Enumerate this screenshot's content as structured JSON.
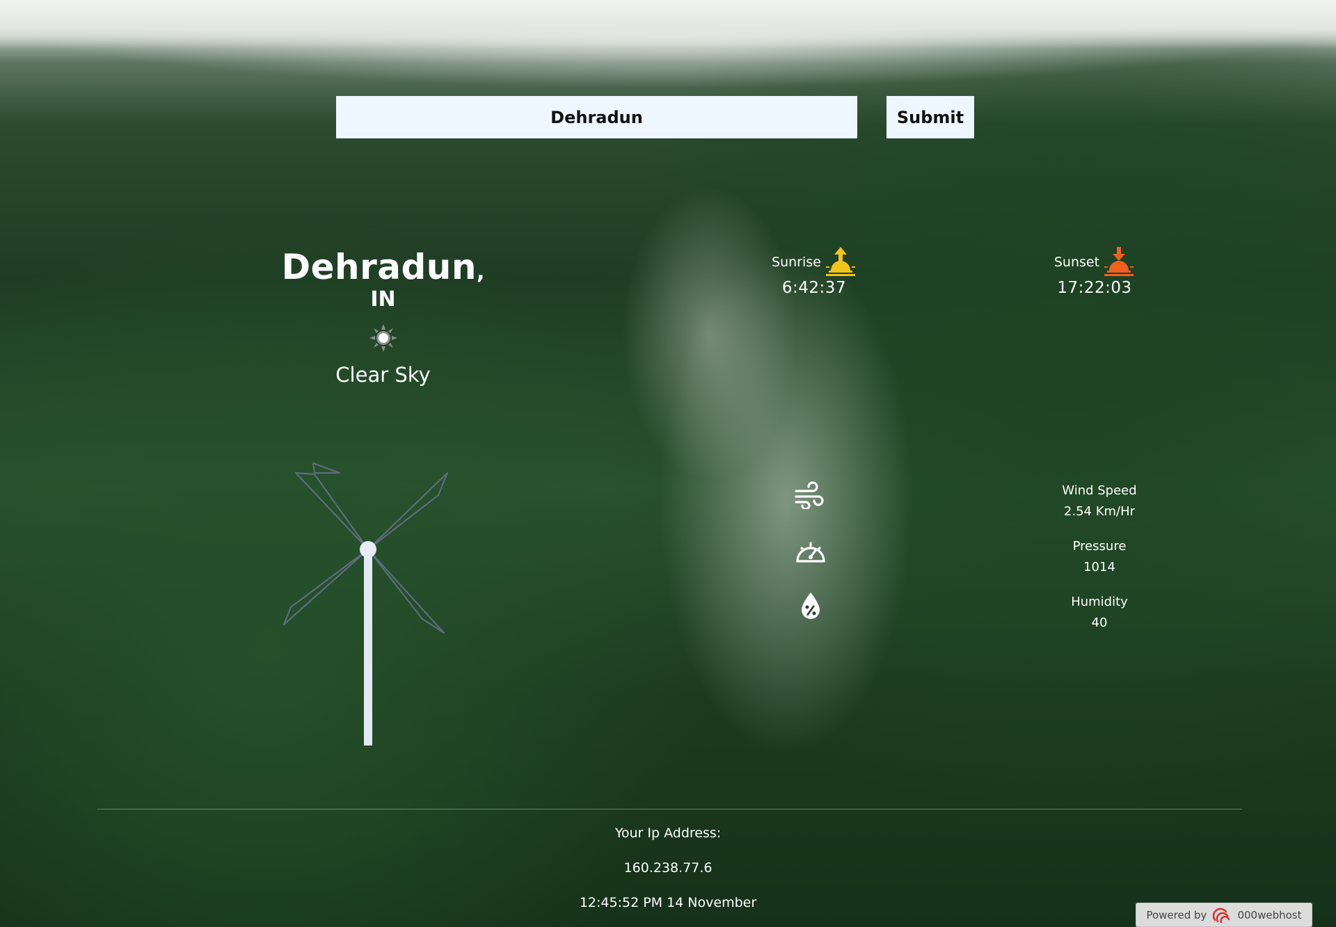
{
  "search": {
    "value": "Dehradun",
    "submit_label": "Submit"
  },
  "location": {
    "city": "Dehradun",
    "country": ", IN"
  },
  "weather": {
    "description": "Clear Sky"
  },
  "sunrise": {
    "label": "Sunrise",
    "time": "6:42:37",
    "icon_color": "#f2c31a"
  },
  "sunset": {
    "label": "Sunset",
    "time": "17:22:03",
    "icon_color": "#f0601e"
  },
  "stats": {
    "wind": {
      "label": "Wind Speed",
      "value": "2.54 Km/Hr"
    },
    "pressure": {
      "label": "Pressure",
      "value": "1014"
    },
    "humidity": {
      "label": "Humidity",
      "value": "40"
    }
  },
  "footer": {
    "ip_label": "Your Ip Address:",
    "ip_value": "160.238.77.6",
    "datetime": "12:45:52 PM 14 November"
  },
  "badge": {
    "prefix": "Powered by",
    "brand": "000webhost"
  }
}
